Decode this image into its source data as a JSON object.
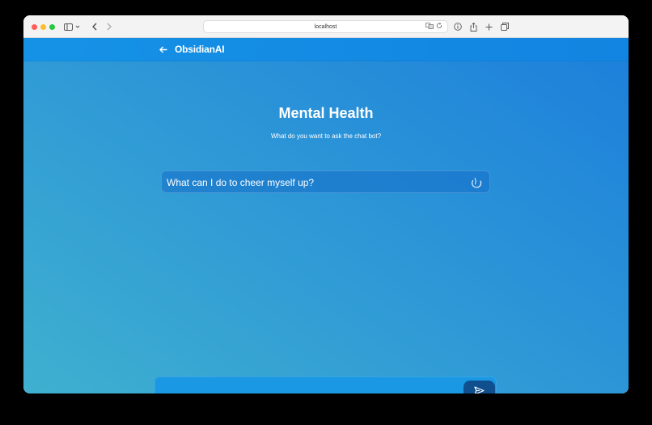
{
  "browser": {
    "url": "localhost"
  },
  "header": {
    "brand": "ObsidianAI"
  },
  "main": {
    "title": "Mental Health",
    "subtitle": "What do you want to ask the chat bot?",
    "question": "What can I do to cheer myself up?"
  },
  "composer": {
    "value": "",
    "placeholder": ""
  },
  "icons": {
    "back": "arrow-left-icon",
    "spinner": "loading-spinner-icon",
    "send": "send-icon"
  }
}
